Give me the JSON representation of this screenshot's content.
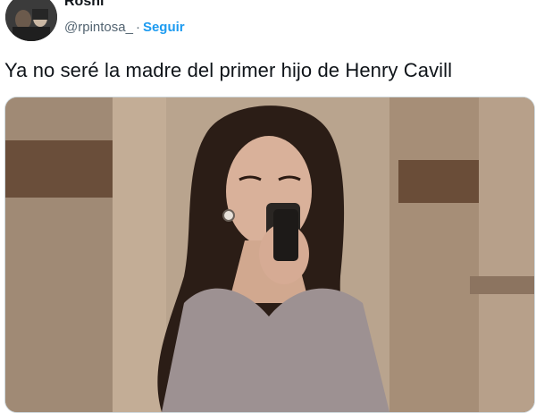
{
  "tweet": {
    "author_name": "Roshi",
    "handle": "@rpintosa_",
    "separator": "·",
    "follow_label": "Seguir",
    "text": "Ya no seré la madre del primer hijo de Henry Cavill",
    "avatar_icon": "profile-photo",
    "media_description_icon": "video-still"
  },
  "colors": {
    "accent": "#1d9bf0",
    "secondary_text": "#536471",
    "primary_text": "#0f1419"
  }
}
